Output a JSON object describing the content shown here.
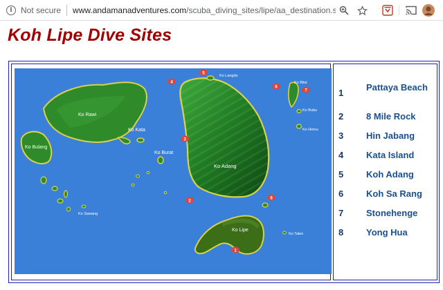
{
  "browser": {
    "security_label": "Not secure",
    "url_host": "www.andamanadventures.com",
    "url_path": "/scuba_diving_sites/lipe/aa_destination.shtml"
  },
  "page": {
    "title": "Koh Lipe Dive Sites"
  },
  "map": {
    "water_color": "#3a7fd8",
    "land_color": "#2f8a2a",
    "marker_color": "#d9473f",
    "island_labels": {
      "rawi": "Ko Rawi",
      "bulang": "Ko Bulang",
      "kata": "Ko Kata",
      "burat": "Ko Burat",
      "adang": "Ko Adang",
      "langdu": "Ko Langdu",
      "bitsi": "Ko Bitsi",
      "bubu": "Ko Bubu",
      "hinnu": "Ko Hinnu",
      "lipe": "Ko Lipe",
      "talen": "Ko Talen",
      "sawang": "Ko Sawang"
    },
    "markers": {
      "m1": "1",
      "m2": "2",
      "m3": "3",
      "m4": "4",
      "m5": "5",
      "m6": "6",
      "m7": "7",
      "m8": "8"
    }
  },
  "dive_sites": [
    {
      "number": "1",
      "name": "Pattaya Beach"
    },
    {
      "number": "2",
      "name": "8 Mile Rock"
    },
    {
      "number": "3",
      "name": "Hin Jabang"
    },
    {
      "number": "4",
      "name": "Kata Island"
    },
    {
      "number": "5",
      "name": "Koh Adang"
    },
    {
      "number": "6",
      "name": "Koh Sa Rang"
    },
    {
      "number": "7",
      "name": "Stonehenge"
    },
    {
      "number": "8",
      "name": "Yong Hua"
    }
  ]
}
